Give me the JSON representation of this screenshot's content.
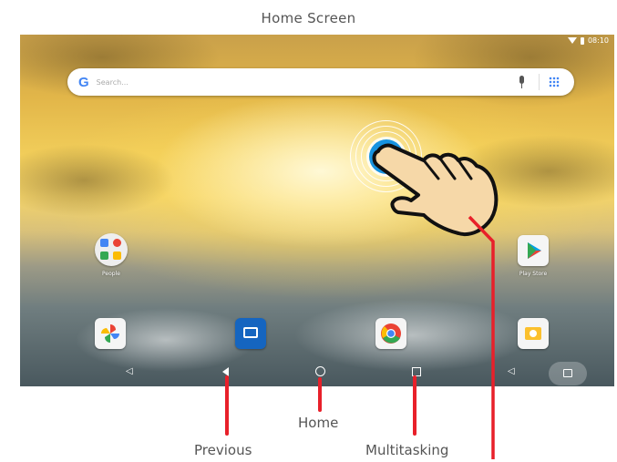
{
  "caption": "Home Screen",
  "status_bar": {
    "time": "08:10",
    "icons": [
      "wifi-icon",
      "battery-icon"
    ]
  },
  "search_bar": {
    "logo": "G",
    "placeholder": "Search...",
    "icons": [
      "mic-icon",
      "apps-grid-icon"
    ]
  },
  "apps": {
    "people": {
      "label": "People",
      "icon": "people-icon"
    },
    "play_store": {
      "label": "Play Store",
      "icon": "play-store-icon"
    }
  },
  "dock": [
    "photos-icon",
    "messages-icon",
    "chrome-icon",
    "camera-icon"
  ],
  "navigation": {
    "buttons": [
      "volume-down-icon",
      "back-icon",
      "home-icon",
      "recents-icon",
      "volume-up-icon",
      "screenshot-icon"
    ]
  },
  "callouts": {
    "home": "Home",
    "previous": "Previous",
    "multitasking": "Multitasking"
  },
  "colors": {
    "annotation_line": "#e8202a",
    "touch_dot": "#1793e0"
  }
}
